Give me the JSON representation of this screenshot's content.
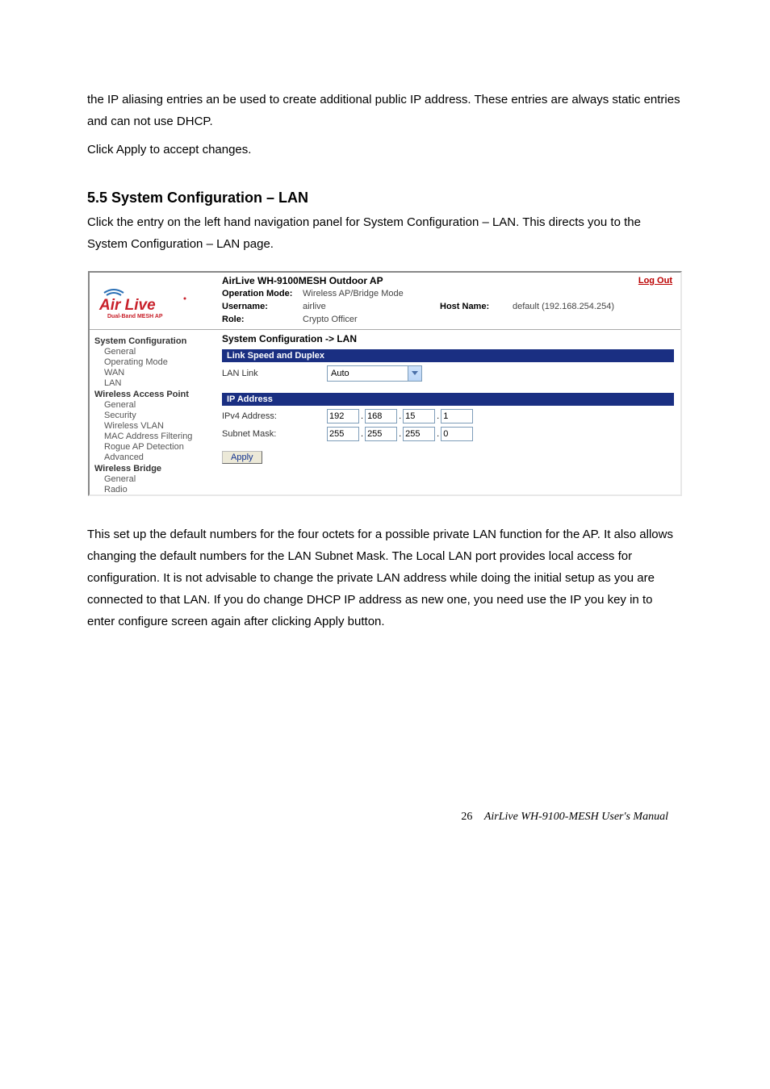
{
  "doc": {
    "para1": "the IP aliasing entries an be used to create additional public IP address. These entries are always static entries and can not use DHCP.",
    "para2": "Click Apply to accept changes.",
    "heading": "5.5 System Configuration – LAN",
    "para3": "Click the entry on the left hand navigation panel for System Configuration – LAN. This directs you to the System Configuration – LAN page.",
    "para4": "This set up the default numbers for the four octets for a possible private LAN function for the AP. It also allows changing the default numbers for the LAN Subnet Mask. The Local LAN port provides local access for configuration. It is not advisable to change the private LAN address while doing the initial setup as you are connected to that LAN. If you do change DHCP IP address as new one, you need use the IP you key in to enter configure screen again after clicking Apply button."
  },
  "ui": {
    "title": "AirLive WH-9100MESH Outdoor AP",
    "logout": "Log Out",
    "info": {
      "op_mode_label": "Operation Mode:",
      "op_mode_value": "Wireless AP/Bridge Mode",
      "username_label": "Username:",
      "username_value": "airlive",
      "role_label": "Role:",
      "role_value": "Crypto Officer",
      "hostname_label": "Host Name:",
      "hostname_value": "default (192.168.254.254)"
    },
    "logo_sub": "Dual-Band MESH AP",
    "nav": {
      "g1": "System Configuration",
      "g1_items": [
        "General",
        "Operating Mode",
        "WAN",
        "LAN"
      ],
      "g2": "Wireless Access Point",
      "g2_items": [
        "General",
        "Security",
        "Wireless VLAN",
        "MAC Address Filtering",
        "Rogue AP Detection",
        "Advanced"
      ],
      "g3": "Wireless Bridge",
      "g3_items": [
        "General",
        "Radio"
      ]
    },
    "crumb": "System Configuration -> LAN",
    "sec1": "Link Speed and Duplex",
    "lan_link_label": "LAN Link",
    "lan_link_value": "Auto",
    "sec2": "IP Address",
    "ipv4_label": "IPv4 Address:",
    "ipv4": [
      "192",
      "168",
      "15",
      "1"
    ],
    "mask_label": "Subnet Mask:",
    "mask": [
      "255",
      "255",
      "255",
      "0"
    ],
    "apply": "Apply"
  },
  "footer": {
    "page": "26",
    "title": "AirLive WH-9100-MESH User's Manual"
  }
}
